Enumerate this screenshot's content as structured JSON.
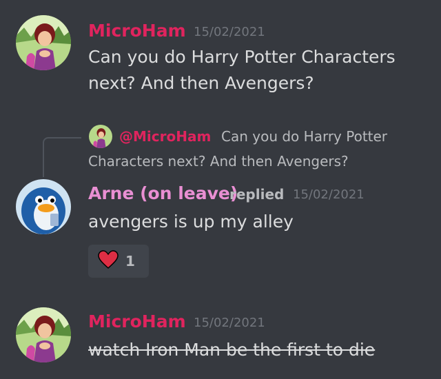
{
  "colors": {
    "background": "#36393f",
    "microham_name": "#e0245e",
    "arne_name": "#e98fd3",
    "text": "#dcddde",
    "muted": "#72767d",
    "reaction_bg": "#40444b"
  },
  "messages": [
    {
      "author": "MicroHam",
      "timestamp": "15/02/2021",
      "lines": [
        "Can you do Harry Potter Characters",
        "next? And then Avengers?"
      ]
    },
    {
      "author": "Arne (on leave)",
      "replied_label": "replied",
      "timestamp": "15/02/2021",
      "text": "avengers is up my alley",
      "reply_to": {
        "author": "@MicroHam",
        "line1": "Can you do Harry Potter",
        "line2": "Characters next? And then Avengers?"
      },
      "reaction": {
        "emoji": "heart-icon",
        "count": "1"
      }
    },
    {
      "author": "MicroHam",
      "timestamp": "15/02/2021",
      "text": "watch Iron Man be the first to die",
      "strikethrough": true
    }
  ]
}
